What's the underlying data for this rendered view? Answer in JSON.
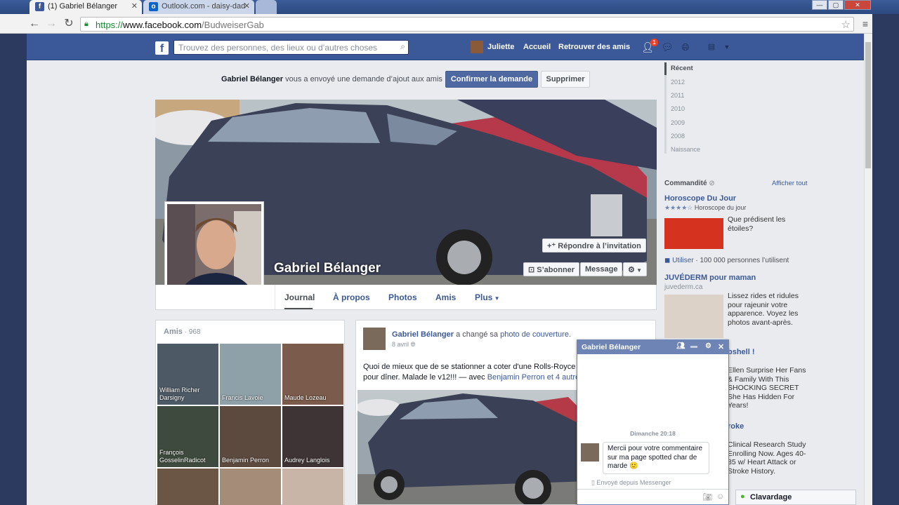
{
  "browser": {
    "tabs": [
      {
        "title": "(1) Gabriel Bélanger",
        "icon": "f"
      },
      {
        "title": "Outlook.com - daisy-dad",
        "icon": "o"
      }
    ],
    "url": {
      "scheme": "https://",
      "host": "www.facebook.com",
      "path": "/BudweiserGab"
    }
  },
  "header": {
    "search_placeholder": "Trouvez des personnes, des lieux ou d’autres choses",
    "user_name": "Juliette",
    "home": "Accueil",
    "find_friends": "Retrouver des amis",
    "friend_requests_count": "1"
  },
  "request_bar": {
    "text_name": "Gabriel Bélanger",
    "text_rest": " vous a envoyé une demande d’ajout aux amis",
    "confirm": "Confirmer la demande",
    "delete": "Supprimer"
  },
  "profile": {
    "name": "Gabriel Bélanger",
    "respond_invitation": "Répondre à l’invitation",
    "subscribe": "S’abonner",
    "message": "Message",
    "tabs": [
      "Journal",
      "À propos",
      "Photos",
      "Amis",
      "Plus"
    ]
  },
  "friends_box": {
    "title": "Amis",
    "count": " · 968",
    "friends": [
      {
        "name": "William Richer Darsigny"
      },
      {
        "name": "Francis Lavoie"
      },
      {
        "name": "Maude Lozeau"
      },
      {
        "name": "François GosselinRadicot"
      },
      {
        "name": "Benjamin Perron"
      },
      {
        "name": "Audrey Langlois"
      },
      {
        "name": ""
      },
      {
        "name": ""
      },
      {
        "name": ""
      }
    ]
  },
  "post": {
    "author": "Gabriel Bélanger",
    "action": " a changé sa ",
    "action_link": "photo de couverture",
    "action_end": ".",
    "date": "8 avril",
    "text": "Quoi de mieux que de se stationner a coter d'une Rolls-Royce G",
    "text2": "pour dîner. Malade le v12!!! — avec ",
    "tagged": "Benjamin Perron",
    "tagged_more": " et 4 autre"
  },
  "timeline": {
    "years": [
      "Récent",
      "2012",
      "2011",
      "2010",
      "2009",
      "2008",
      "Naissance"
    ]
  },
  "ads": {
    "header": "Commandité",
    "see_all": "Afficher tout",
    "ad1": {
      "title": "Horoscope Du Jour",
      "rating_label": "Horoscope du jour",
      "text": "Que prédisent les étoiles?",
      "use": "Utiliser",
      "users": " · 100 000 personnes l’utilisent"
    },
    "ad2": {
      "title": "JUVÉDERM pour maman",
      "domain": "juvederm.ca",
      "text": "Lissez rides et ridules pour rajeunir votre apparence. Voyez les photos avant-après."
    },
    "ad3": {
      "title": "bshell !",
      "text": "Ellen Surprise Her Fans & Family With This SHOCKING SECRET She Has Hidden For Years!"
    },
    "ad4": {
      "title": "roke",
      "text": "Clinical Research Study Enrolling Now. Ages 40-85 w/ Heart Attack or Stroke History."
    }
  },
  "chat": {
    "title": "Gabriel Bélanger",
    "timestamp": "Dimanche 20:18",
    "message": "Mercii pour votre commentaire sur ma page spotted char de marde 🙂",
    "sent_from": "Envoyé depuis Messenger",
    "chat_bar": "Clavardage"
  }
}
